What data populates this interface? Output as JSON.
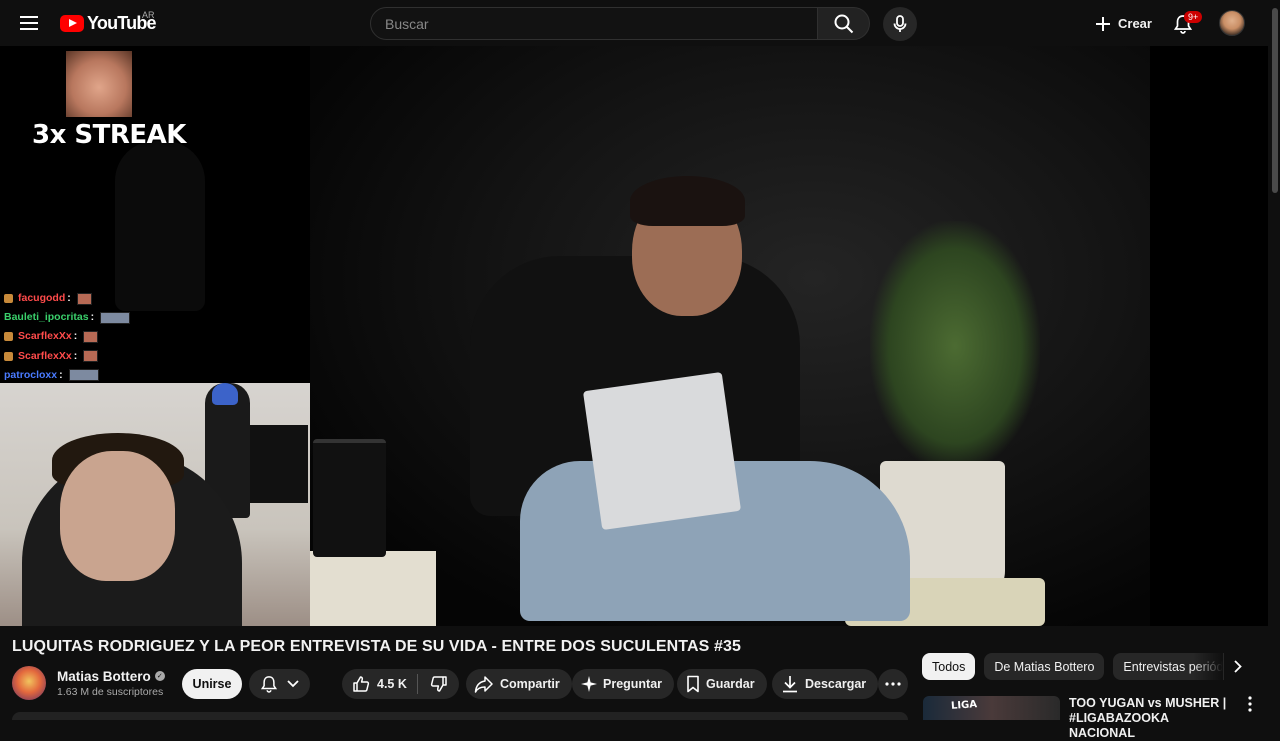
{
  "header": {
    "logo_text": "YouTube",
    "country_code": "AR",
    "search_placeholder": "Buscar",
    "create_label": "Crear",
    "notification_badge": "9+"
  },
  "overlay": {
    "streak_text": "3x STREAK",
    "chat": [
      {
        "user": "facugodd",
        "color": "#ff4b4b",
        "badge": true,
        "emote": "small"
      },
      {
        "user": "Bauleti_ipocritas",
        "color": "#3ad06b",
        "badge": false,
        "emote": "wide"
      },
      {
        "user": "ScarflexXx",
        "color": "#ff4b4b",
        "badge": true,
        "emote": "small"
      },
      {
        "user": "ScarflexXx",
        "color": "#ff4b4b",
        "badge": true,
        "emote": "small"
      },
      {
        "user": "patrocloxx",
        "color": "#4a7bff",
        "badge": false,
        "emote": "wide"
      }
    ]
  },
  "video": {
    "title": "LUQUITAS RODRIGUEZ Y LA PEOR ENTREVISTA DE SU VIDA - ENTRE DOS SUCULENTAS #35",
    "channel_name": "Matias Bottero",
    "subscribers": "1.63 M de suscriptores",
    "join_label": "Unirse",
    "like_count": "4.5 K",
    "share_label": "Compartir",
    "ask_label": "Preguntar",
    "save_label": "Guardar",
    "download_label": "Descargar"
  },
  "sidebar": {
    "chips": [
      "Todos",
      "De Matias Bottero",
      "Entrevistas periódi"
    ],
    "recommendation": {
      "title": "TOO YUGAN vs MUSHER | #LIGABAZOOKA NACIONAL",
      "thumb_text": "LIGA"
    }
  },
  "colors": {
    "background": "#0f0f0f",
    "brand_red": "#ff0000",
    "chip_active": "#f1f1f1"
  }
}
